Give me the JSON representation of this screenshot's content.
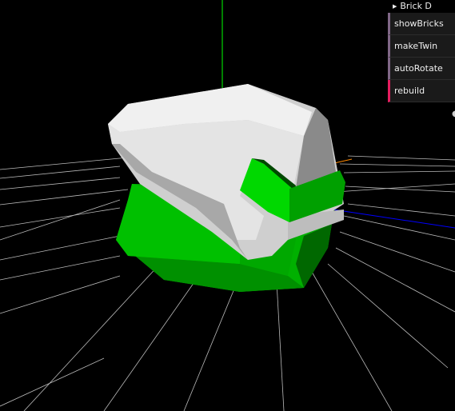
{
  "gui": {
    "folder_label": "Brick D",
    "controls": [
      {
        "label": "showBricks",
        "type": "checkbox"
      },
      {
        "label": "makeTwin",
        "type": "checkbox"
      },
      {
        "label": "autoRotate",
        "type": "checkbox"
      },
      {
        "label": "rebuild",
        "type": "button"
      }
    ]
  },
  "scene": {
    "background": "#000000",
    "grid_color": "#c8c8c8",
    "y_axis_color": "#00ff00",
    "z_axis_color": "#0000ff",
    "x_axis_color": "#ff8800",
    "twin_brick_color": "#00c000",
    "brick_color": "#d4d4d4"
  }
}
